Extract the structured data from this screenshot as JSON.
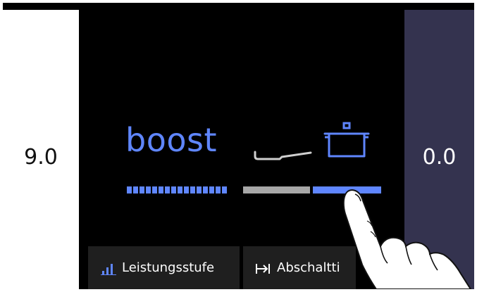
{
  "left_zone": {
    "value": "9.0"
  },
  "right_zone": {
    "value": "0.0"
  },
  "center": {
    "mode_label": "boost"
  },
  "bottom_tabs": [
    {
      "label": "Leistungsstufe",
      "icon": "bar-chart-icon"
    },
    {
      "label": "Abschaltti",
      "icon": "arrow-right-bar-icon"
    }
  ],
  "colors": {
    "accent_blue": "#5f86ff",
    "inactive_gray": "#a7a7a7",
    "right_panel": "#34334f",
    "tab_bg": "#1f1f1f"
  }
}
